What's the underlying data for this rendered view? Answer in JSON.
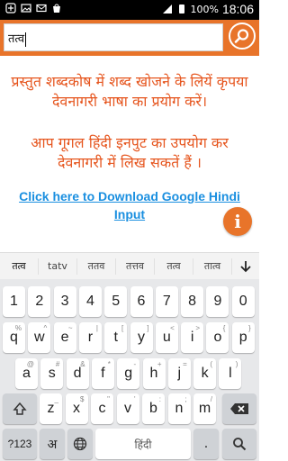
{
  "status_bar": {
    "left_icons": [
      "notification-icon",
      "image-icon",
      "mail-icon",
      "store-icon"
    ],
    "battery": "100%",
    "time": "18:06"
  },
  "search": {
    "value": "तत्व"
  },
  "content": {
    "para1": "प्रस्तुत शब्दकोष में शब्द खोजने के लियें कृपया देवनागरी भाषा का प्रयोग करें।",
    "para2": "आप गूगल हिंदी इनपुट का उपयोग कर देवनागरी में लिख सकतें हैं ।",
    "download_link": "Click here to Download Google Hindi Input",
    "info_label": "i"
  },
  "suggestions": [
    "तत्व",
    "tatv",
    "ततव",
    "तत्तव",
    "तत्व",
    "तात्व"
  ],
  "keyboard": {
    "row1": [
      {
        "k": "1"
      },
      {
        "k": "2"
      },
      {
        "k": "3"
      },
      {
        "k": "4"
      },
      {
        "k": "5"
      },
      {
        "k": "6"
      },
      {
        "k": "7"
      },
      {
        "k": "8"
      },
      {
        "k": "9"
      },
      {
        "k": "0"
      }
    ],
    "row2": [
      {
        "k": "q",
        "s": "%"
      },
      {
        "k": "w",
        "s": "^"
      },
      {
        "k": "e",
        "s": "~"
      },
      {
        "k": "r",
        "s": "|"
      },
      {
        "k": "t",
        "s": "["
      },
      {
        "k": "y",
        "s": "]"
      },
      {
        "k": "u",
        "s": "<"
      },
      {
        "k": "i",
        "s": ">"
      },
      {
        "k": "o",
        "s": "{"
      },
      {
        "k": "p",
        "s": "}"
      }
    ],
    "row3": [
      {
        "k": "a",
        "s": "@"
      },
      {
        "k": "s",
        "s": "#"
      },
      {
        "k": "d",
        "s": "&"
      },
      {
        "k": "f",
        "s": "*"
      },
      {
        "k": "g",
        "s": "-"
      },
      {
        "k": "h",
        "s": "+"
      },
      {
        "k": "j",
        "s": "="
      },
      {
        "k": "k",
        "s": "("
      },
      {
        "k": "l",
        "s": ")"
      }
    ],
    "row4": [
      {
        "k": "z",
        "s": "_"
      },
      {
        "k": "x",
        "s": "$"
      },
      {
        "k": "c",
        "s": "\""
      },
      {
        "k": "v",
        "s": "'"
      },
      {
        "k": "b",
        "s": ":"
      },
      {
        "k": "n",
        "s": ";"
      },
      {
        "k": "m",
        "s": "/"
      }
    ],
    "bottom": {
      "symbols": "?123",
      "lang": "अ",
      "space": "हिंदी",
      "period": "."
    }
  }
}
